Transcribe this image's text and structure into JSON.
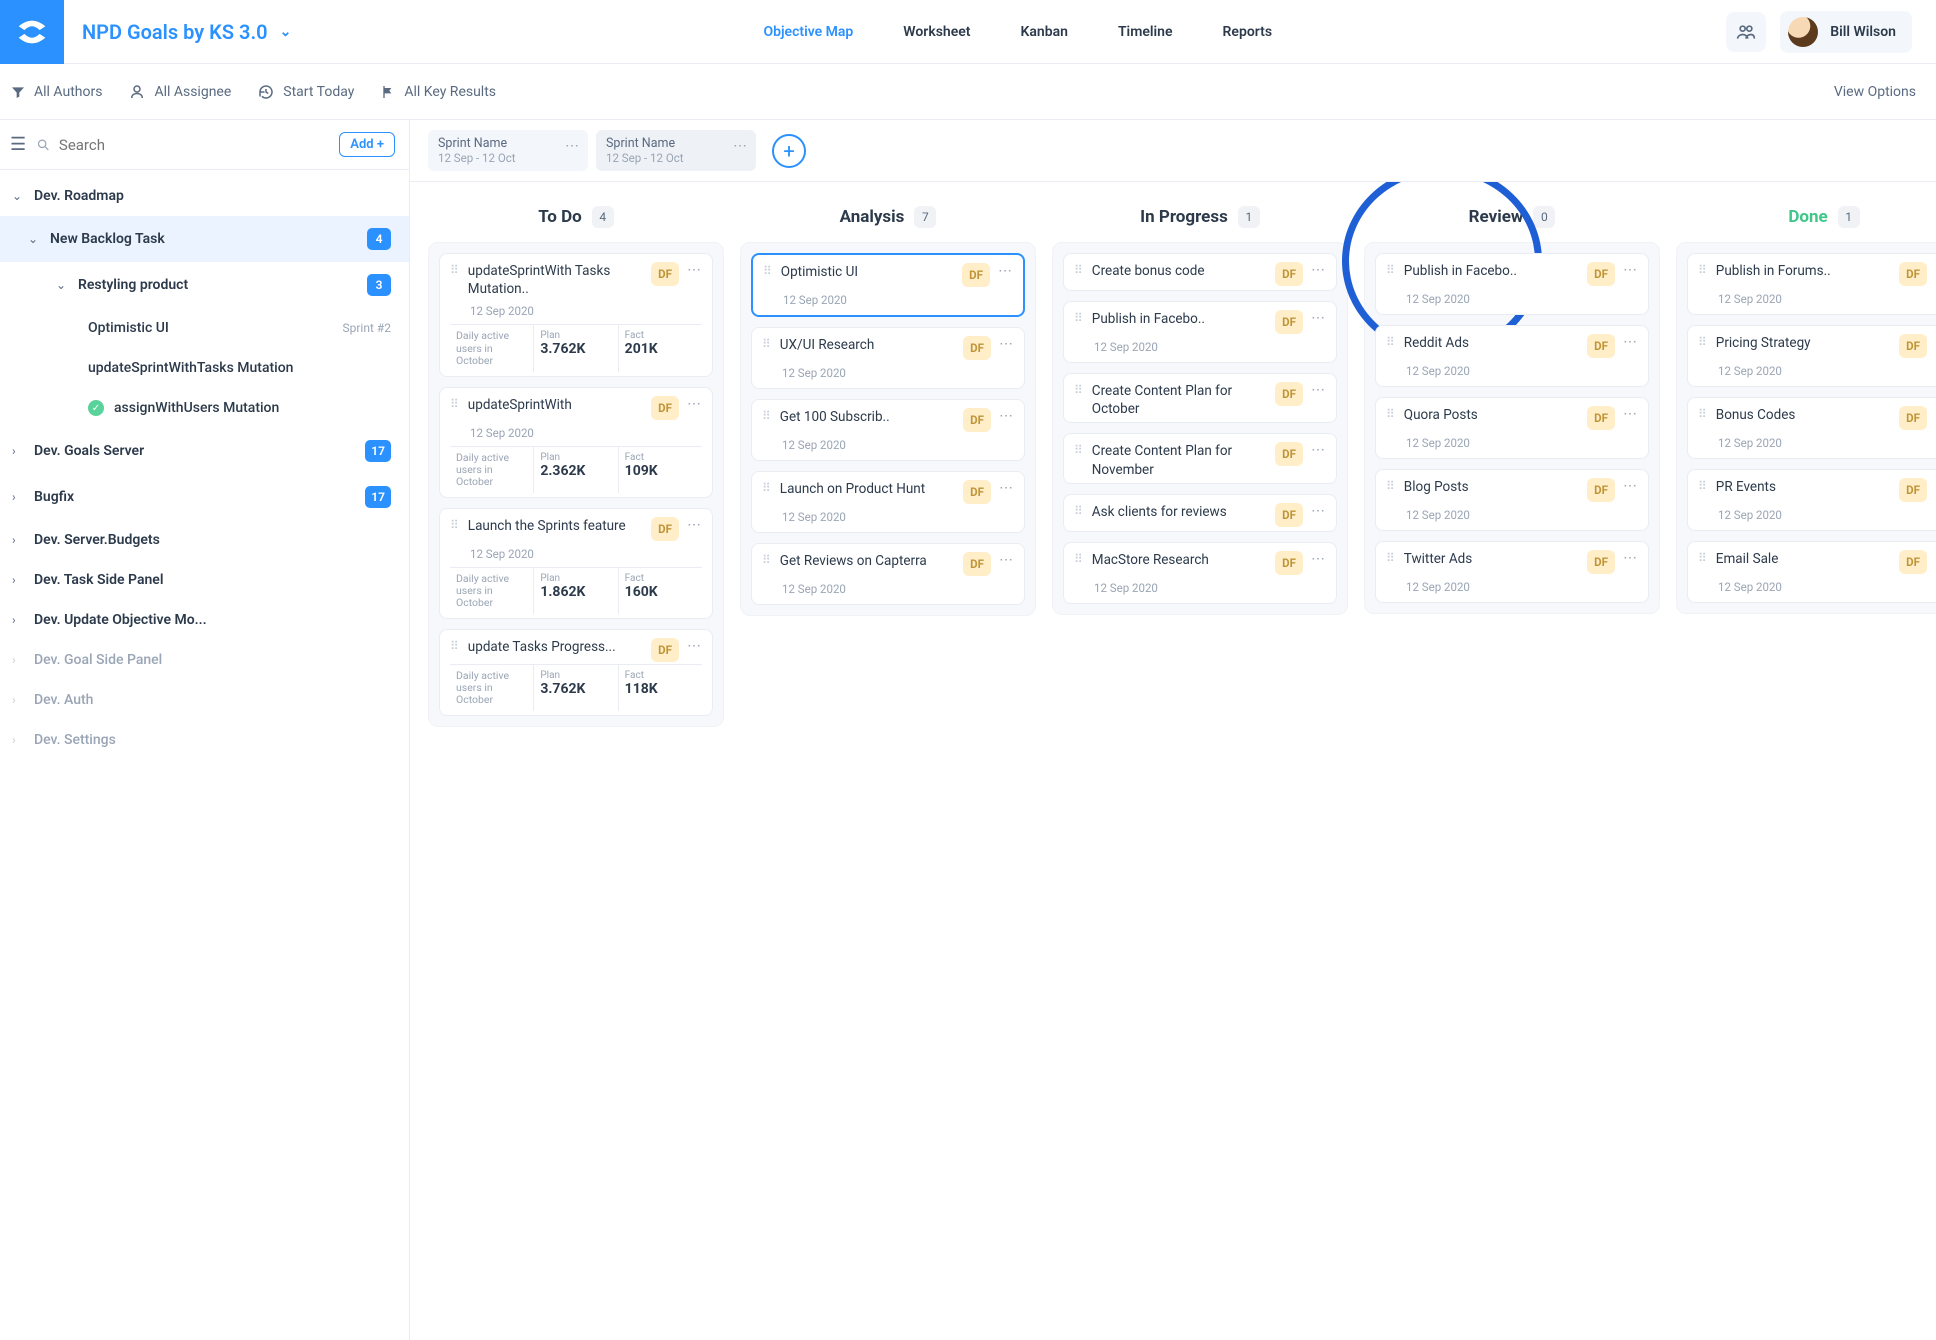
{
  "header": {
    "project_title": "NPD Goals by KS 3.0",
    "nav": [
      "Objective Map",
      "Worksheet",
      "Kanban",
      "Timeline",
      "Reports"
    ],
    "user_name": "Bill Wilson"
  },
  "toolbar": {
    "authors": "All Authors",
    "assignee": "All Assignee",
    "start": "Start Today",
    "results": "All Key Results",
    "view_options": "View Options"
  },
  "sidebar": {
    "search_placeholder": "Search",
    "add_label": "Add +",
    "tree": [
      {
        "label": "Dev. Roadmap",
        "depth": 0,
        "open": true
      },
      {
        "label": "New Backlog Task",
        "depth": 1,
        "open": true,
        "badge": "4",
        "selected": true
      },
      {
        "label": "Restyling product",
        "depth": 2,
        "open": true,
        "badge": "3"
      },
      {
        "label": "Optimistic UI",
        "depth": 3,
        "leaf": true,
        "meta": "Sprint #2"
      },
      {
        "label": "updateSprintWithTasks Mutation",
        "depth": 3,
        "leaf": true
      },
      {
        "label": "assignWithUsers Mutation",
        "depth": 3,
        "leaf": true,
        "muted": true,
        "green": true
      },
      {
        "label": "Dev. Goals Server",
        "depth": 0,
        "badge": "17"
      },
      {
        "label": "Bugfix",
        "depth": 0,
        "badge": "17"
      },
      {
        "label": "Dev. Server.Budgets",
        "depth": 0
      },
      {
        "label": "Dev. Task Side Panel",
        "depth": 0
      },
      {
        "label": "Dev. Update Objective Mo...",
        "depth": 0
      },
      {
        "label": "Dev. Goal Side Panel",
        "depth": 0,
        "muted": true
      },
      {
        "label": "Dev. Auth",
        "depth": 0,
        "muted": true
      },
      {
        "label": "Dev. Settings",
        "depth": 0,
        "muted": true
      }
    ]
  },
  "sprints": [
    {
      "name": "Sprint Name",
      "dates": "12 Sep - 12 Oct"
    },
    {
      "name": "Sprint Name",
      "dates": "12 Sep - 12 Oct",
      "active": true
    }
  ],
  "columns": [
    {
      "title": "To Do",
      "count": "4",
      "cards": [
        {
          "title": "updateSprintWith Tasks Mutation..",
          "date": "12 Sep 2020",
          "assignee": "DF",
          "metrics": {
            "label": "Daily active users in October",
            "plan": "3.762K",
            "fact": "201K"
          }
        },
        {
          "title": "updateSprintWith",
          "date": "12 Sep 2020",
          "assignee": "DF",
          "metrics": {
            "label": "Daily active users in October",
            "plan": "2.362K",
            "fact": "109K"
          }
        },
        {
          "title": "Launch the Sprints feature",
          "date": "12 Sep 2020",
          "assignee": "DF",
          "metrics": {
            "label": "Daily active users in October",
            "plan": "1.862K",
            "fact": "160K"
          }
        },
        {
          "title": "update Tasks Progress...",
          "date": "",
          "assignee": "DF",
          "metrics": {
            "label": "Daily active users in October",
            "plan": "3.762K",
            "fact": "118K"
          }
        }
      ]
    },
    {
      "title": "Analysis",
      "count": "7",
      "cards": [
        {
          "title": "Optimistic UI",
          "date": "12 Sep 2020",
          "assignee": "DF",
          "highlight": true
        },
        {
          "title": "UX/UI Research",
          "date": "12 Sep 2020",
          "assignee": "DF"
        },
        {
          "title": "Get 100 Subscrib..",
          "date": "12 Sep 2020",
          "assignee": "DF"
        },
        {
          "title": "Launch on Product Hunt",
          "date": "12 Sep 2020",
          "assignee": "DF"
        },
        {
          "title": "Get Reviews on Capterra",
          "date": "12 Sep 2020",
          "assignee": "DF"
        }
      ]
    },
    {
      "title": "In Progress",
      "count": "1",
      "cards": [
        {
          "title": "Create bonus code",
          "date": "",
          "assignee": "DF"
        },
        {
          "title": "Publish in Facebo..",
          "date": "12 Sep 2020",
          "assignee": "DF"
        },
        {
          "title": "Create Content Plan for October",
          "date": "",
          "assignee": "DF"
        },
        {
          "title": "Create Content Plan for November",
          "date": "",
          "assignee": "DF"
        },
        {
          "title": "Ask clients for reviews",
          "date": "",
          "assignee": "DF"
        },
        {
          "title": "MacStore Research",
          "date": "12 Sep 2020",
          "assignee": "DF"
        }
      ]
    },
    {
      "title": "Review",
      "count": "0",
      "cards": [
        {
          "title": "Publish in Facebo..",
          "date": "12 Sep 2020",
          "assignee": "DF"
        },
        {
          "title": "Reddit Ads",
          "date": "12 Sep 2020",
          "assignee": "DF"
        },
        {
          "title": "Quora Posts",
          "date": "12 Sep 2020",
          "assignee": "DF"
        },
        {
          "title": "Blog Posts",
          "date": "12 Sep 2020",
          "assignee": "DF"
        },
        {
          "title": "Twitter Ads",
          "date": "12 Sep 2020",
          "assignee": "DF"
        }
      ]
    },
    {
      "title": "Done",
      "count": "1",
      "done": true,
      "cards": [
        {
          "title": "Publish in Forums..",
          "date": "12 Sep 2020",
          "assignee": "DF"
        },
        {
          "title": "Pricing Strategy",
          "date": "12 Sep 2020",
          "assignee": "DF"
        },
        {
          "title": "Bonus Codes",
          "date": "12 Sep 2020",
          "assignee": "DF"
        },
        {
          "title": "PR Events",
          "date": "12 Sep 2020",
          "assignee": "DF"
        },
        {
          "title": "Email Sale",
          "date": "12 Sep 2020",
          "assignee": "DF"
        }
      ]
    }
  ],
  "labels": {
    "plan": "Plan",
    "fact": "Fact"
  }
}
